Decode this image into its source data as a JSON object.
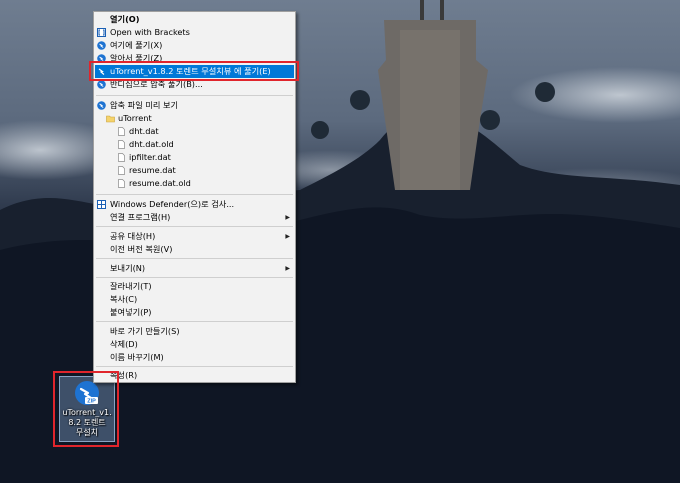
{
  "context_menu": {
    "items": [
      {
        "label": "열기(O)",
        "bold": true
      },
      {
        "label": "Open with Brackets",
        "icon": "brackets-icon"
      },
      {
        "label": "여기에 풀기(X)",
        "icon": "bandizip-icon"
      },
      {
        "label": "알아서 풀기(Z)",
        "icon": "bandizip-icon"
      },
      {
        "label": "uTorrent_v1.8.2 토렌트 무설치뷰 에 풀기(E)",
        "icon": "bandizip-icon",
        "highlighted": true
      },
      {
        "label": "반디집으로 압축 풀기(B)...",
        "icon": "bandizip-icon"
      },
      {
        "label": "압축 파일 미리 보기",
        "icon": "bandizip-icon"
      },
      {
        "label": "uTorrent",
        "icon": "folder-icon"
      },
      {
        "label": "dht.dat",
        "icon": "file-icon"
      },
      {
        "label": "dht.dat.old",
        "icon": "file-icon"
      },
      {
        "label": "ipfilter.dat",
        "icon": "file-icon"
      },
      {
        "label": "resume.dat",
        "icon": "file-icon"
      },
      {
        "label": "resume.dat.old",
        "icon": "file-icon"
      },
      {
        "label": "Windows Defender(으)로 검사...",
        "icon": "defender-icon"
      },
      {
        "label": "연결 프로그램(H)",
        "submenu": true
      },
      {
        "label": "공유 대상(H)",
        "submenu": true
      },
      {
        "label": "이전 버전 복원(V)"
      },
      {
        "label": "보내기(N)",
        "submenu": true
      },
      {
        "label": "잘라내기(T)"
      },
      {
        "label": "복사(C)"
      },
      {
        "label": "붙여넣기(P)"
      },
      {
        "label": "바로 가기 만들기(S)"
      },
      {
        "label": "삭제(D)"
      },
      {
        "label": "이름 바꾸기(M)"
      },
      {
        "label": "속성(R)"
      }
    ],
    "submenu_arrow": "▶"
  },
  "desktop_icon": {
    "badge": "ZIP",
    "label_lines": [
      "uTorrent_v1.",
      "8.2 토렌트",
      "무설치"
    ]
  },
  "colors": {
    "highlight": "#0078d7",
    "annotation_red": "#e0252c",
    "bandizip_blue": "#1e73d2"
  }
}
